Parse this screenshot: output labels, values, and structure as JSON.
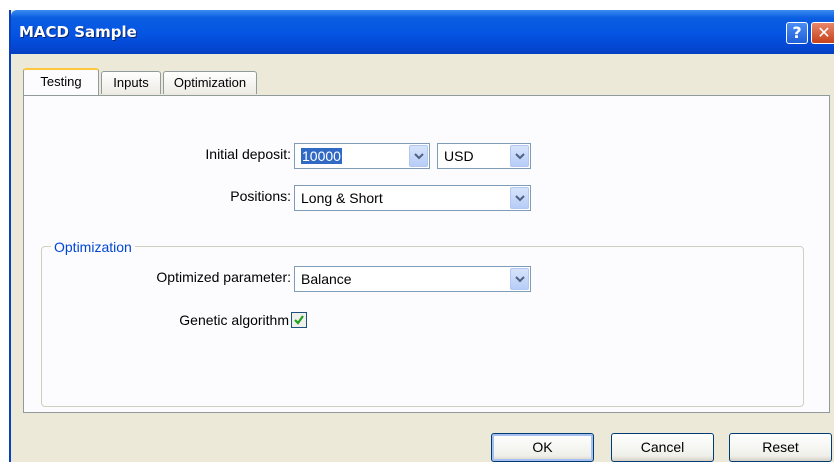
{
  "window": {
    "title": "MACD Sample",
    "help_glyph": "?",
    "close_glyph": "✕"
  },
  "tabs": [
    {
      "label": "Testing",
      "active": true
    },
    {
      "label": "Inputs",
      "active": false
    },
    {
      "label": "Optimization",
      "active": false
    }
  ],
  "testing": {
    "initial_deposit_label": "Initial deposit:",
    "initial_deposit_value": "10000",
    "currency_value": "USD",
    "positions_label": "Positions:",
    "positions_value": "Long & Short"
  },
  "optimization_group": {
    "title": "Optimization",
    "optimized_parameter_label": "Optimized parameter:",
    "optimized_parameter_value": "Balance",
    "genetic_algorithm_label": "Genetic algorithm",
    "genetic_algorithm_checked": true
  },
  "buttons": {
    "ok": "OK",
    "cancel": "Cancel",
    "reset": "Reset"
  },
  "colors": {
    "titlebar": "#0554e3",
    "group_title": "#0046d5",
    "selection": "#316ac5",
    "check": "#21a121"
  },
  "icons": [
    "help-icon",
    "close-icon",
    "dropdown-arrow-icon",
    "checkmark-icon"
  ]
}
